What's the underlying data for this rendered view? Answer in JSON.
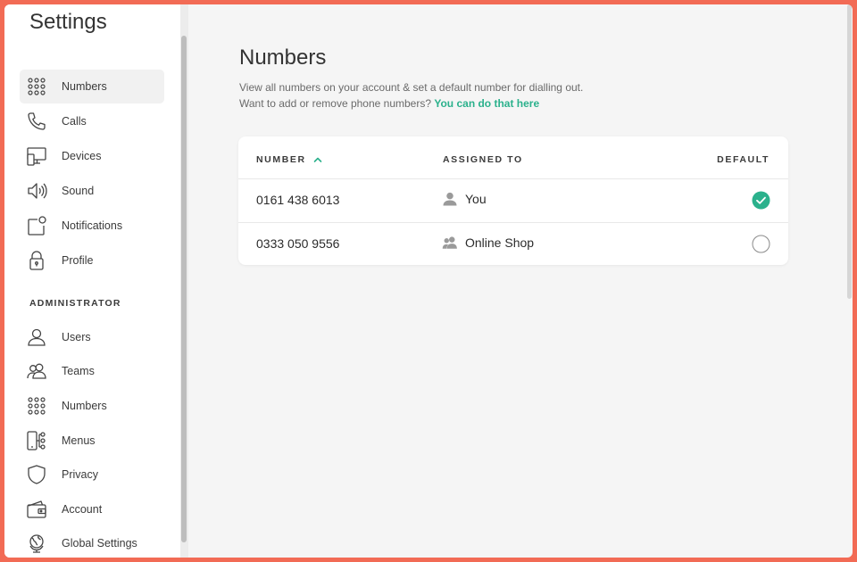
{
  "colors": {
    "accent": "#2bb18c",
    "frame": "#f26b55"
  },
  "sidebar": {
    "title": "Settings",
    "items": [
      {
        "label": "Numbers",
        "icon": "keypad-icon",
        "active": true
      },
      {
        "label": "Calls",
        "icon": "phone-icon"
      },
      {
        "label": "Devices",
        "icon": "devices-icon"
      },
      {
        "label": "Sound",
        "icon": "speaker-icon"
      },
      {
        "label": "Notifications",
        "icon": "notification-icon"
      },
      {
        "label": "Profile",
        "icon": "lock-icon"
      }
    ],
    "admin_section_label": "ADMINISTRATOR",
    "admin_items": [
      {
        "label": "Users",
        "icon": "user-icon"
      },
      {
        "label": "Teams",
        "icon": "team-icon"
      },
      {
        "label": "Numbers",
        "icon": "keypad-icon"
      },
      {
        "label": "Menus",
        "icon": "menu-tree-icon"
      },
      {
        "label": "Privacy",
        "icon": "shield-icon"
      },
      {
        "label": "Account",
        "icon": "wallet-icon"
      },
      {
        "label": "Global Settings",
        "icon": "globe-icon"
      }
    ]
  },
  "main": {
    "title": "Numbers",
    "description_line1": "View all numbers on your account & set a default number for dialling out.",
    "description_line2": "Want to add or remove phone numbers?",
    "description_link": "You can do that here",
    "table": {
      "headers": {
        "number": "NUMBER",
        "assigned_to": "ASSIGNED TO",
        "default": "DEFAULT"
      },
      "sort": "number-ascending",
      "rows": [
        {
          "number": "0161 438 6013",
          "assigned_to": "You",
          "assignee_icon": "user-icon",
          "default": true
        },
        {
          "number": "0333 050 9556",
          "assigned_to": "Online Shop",
          "assignee_icon": "team-icon",
          "default": false
        }
      ]
    }
  }
}
